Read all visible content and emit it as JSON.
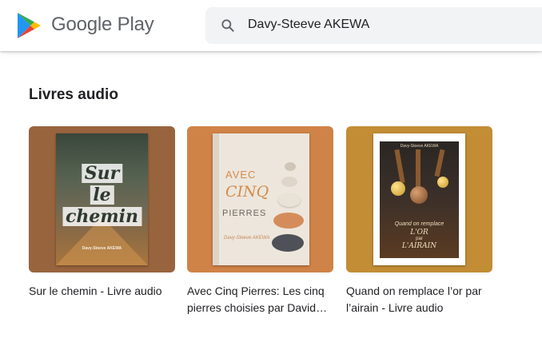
{
  "header": {
    "brand": "Google Play",
    "search": {
      "value": "Davy-Steeve AKEWA"
    }
  },
  "section": {
    "title": "Livres audio",
    "items": [
      {
        "title": "Sur le chemin - Livre audio",
        "tile_color": "#98643e",
        "cover": {
          "words": [
            "Sur",
            "le",
            "chemin"
          ],
          "author": "Davy-Steeve AKEWA"
        }
      },
      {
        "title": "Avec Cinq Pierres: Les cinq pierres choisies par David contre Goliath",
        "tile_color": "#d08347",
        "cover": {
          "line1": "AVEC",
          "line2": "CINQ",
          "line3": "PIERRES",
          "author": "Davy-Steeve AKEWA"
        }
      },
      {
        "title": "Quand on remplace l’or par l’airain - Livre audio",
        "tile_color": "#c38d35",
        "cover": {
          "author": "Davy-Steeve AKEWA",
          "line1": "Quand on remplace",
          "line2": "L'OR",
          "line3": "par",
          "line4": "L'AIRAIN"
        }
      }
    ]
  },
  "colors": {
    "search_bg": "#f1f3f4",
    "text": "#202124",
    "brand_text": "#5f6368"
  }
}
